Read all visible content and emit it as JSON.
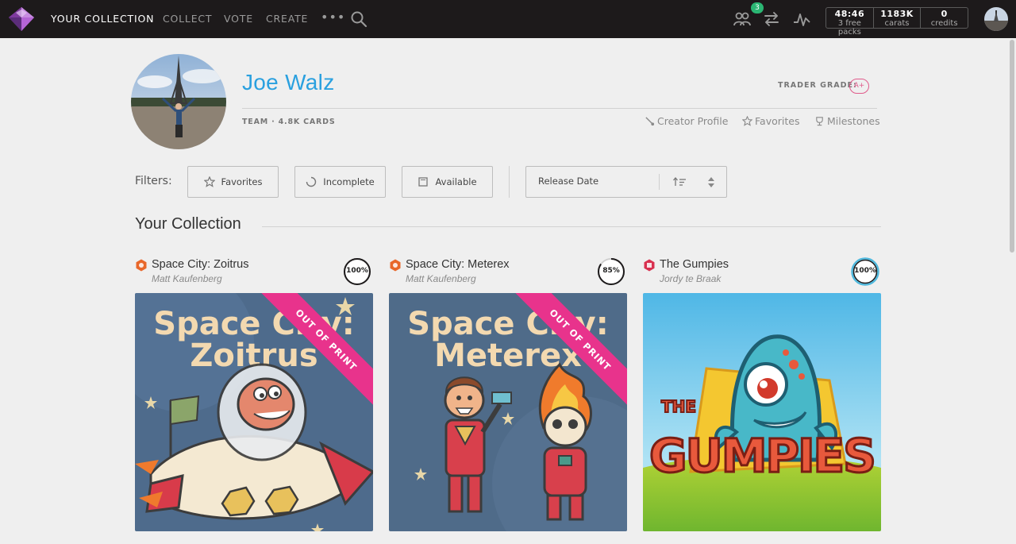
{
  "nav": {
    "items": [
      "YOUR COLLECTION",
      "COLLECT",
      "VOTE",
      "CREATE"
    ],
    "more": "•••",
    "badge": "3",
    "stats": [
      {
        "top": "48:46",
        "bottom": "3 free packs"
      },
      {
        "top": "1183K",
        "bottom": "carats"
      },
      {
        "top": "0",
        "bottom": "credits"
      }
    ]
  },
  "profile": {
    "name": "Joe Walz",
    "trader_label": "TRADER GRADE:",
    "grade": "A+",
    "team": "TEAM",
    "cards": "4.8K CARDS",
    "links": [
      "Creator Profile",
      "Favorites",
      "Milestones"
    ]
  },
  "filters": {
    "label": "Filters:",
    "buttons": [
      "Favorites",
      "Incomplete",
      "Available"
    ],
    "sort": "Release Date"
  },
  "section": {
    "title": "Your Collection"
  },
  "cards": [
    {
      "title": "Space City: Zoitrus",
      "artist": "Matt Kaufenberg",
      "progress": "100%",
      "progress_value": 100,
      "banner": "OUT OF PRINT",
      "art_lines": [
        "Space City:",
        "Zoitrus"
      ],
      "set_color": "#e8672a"
    },
    {
      "title": "Space City: Meterex",
      "artist": "Matt Kaufenberg",
      "progress": "85%",
      "progress_value": 85,
      "banner": "OUT OF PRINT",
      "art_lines": [
        "Space City:",
        "Meterex"
      ],
      "set_color": "#e8672a"
    },
    {
      "title": "The Gumpies",
      "artist": "Jordy te Braak",
      "progress": "100%",
      "progress_value": 100,
      "art_lines": [
        "THE",
        "GUMPIES"
      ],
      "set_color": "#d8304f"
    }
  ],
  "colors": {
    "accent": "#2aa0df",
    "grade": "#e05b8b",
    "banner": "#e8338c",
    "nav_bg": "#1d1a1b"
  }
}
